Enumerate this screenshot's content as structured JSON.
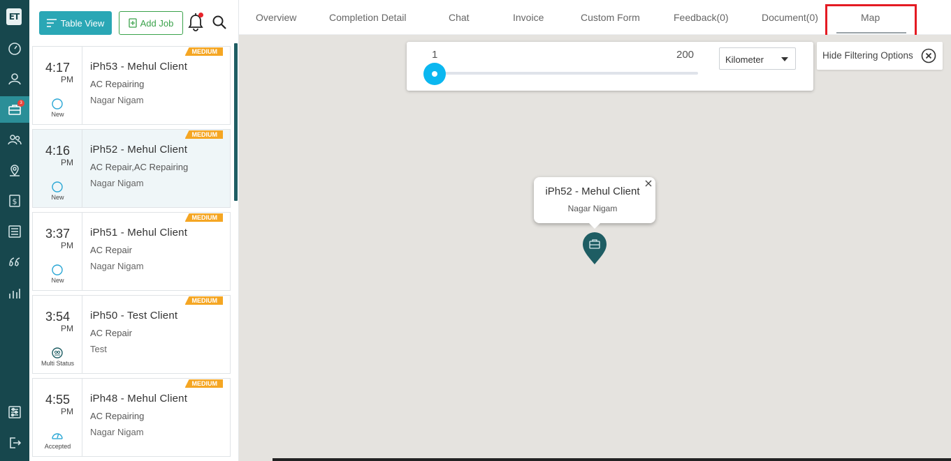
{
  "app": {
    "logo_text": "ET"
  },
  "rail": {
    "items": [
      {
        "icon": "dashboard-icon"
      },
      {
        "icon": "user-icon"
      },
      {
        "icon": "briefcase-icon",
        "badge": "3",
        "active": true
      },
      {
        "icon": "users-icon"
      },
      {
        "icon": "location-icon"
      },
      {
        "icon": "dollar-icon"
      },
      {
        "icon": "list-icon"
      },
      {
        "icon": "quote-icon"
      },
      {
        "icon": "reports-icon"
      },
      {
        "icon": "settings-sliders-icon"
      },
      {
        "icon": "logout-icon"
      }
    ]
  },
  "toolbar": {
    "table_view_label": "Table View",
    "add_job_label": "Add Job"
  },
  "jobs": [
    {
      "time": "4:17",
      "ampm": "PM",
      "title": "iPh53 - Mehul Client",
      "service": "AC Repairing",
      "location": "Nagar Nigam",
      "status": "New",
      "priority": "MEDIUM",
      "selected": false
    },
    {
      "time": "4:16",
      "ampm": "PM",
      "title": "iPh52 - Mehul Client",
      "service": "AC Repair,AC Repairing",
      "location": "Nagar Nigam",
      "status": "New",
      "priority": "MEDIUM",
      "selected": true
    },
    {
      "time": "3:37",
      "ampm": "PM",
      "title": "iPh51 - Mehul Client",
      "service": "AC Repair",
      "location": "Nagar Nigam",
      "status": "New",
      "priority": "MEDIUM",
      "selected": false
    },
    {
      "time": "3:54",
      "ampm": "PM",
      "title": "iPh50 - Test Client",
      "service": "AC Repair",
      "location": "Test",
      "status": "Multi Status",
      "priority": "MEDIUM",
      "selected": false
    },
    {
      "time": "4:55",
      "ampm": "PM",
      "title": "iPh48 - Mehul Client",
      "service": "AC Repairing",
      "location": "Nagar Nigam",
      "status": "Accepted",
      "priority": "MEDIUM",
      "selected": false
    }
  ],
  "tabs": [
    {
      "label": "Overview"
    },
    {
      "label": "Completion Detail"
    },
    {
      "label": "Chat"
    },
    {
      "label": "Invoice"
    },
    {
      "label": "Custom Form"
    },
    {
      "label": "Feedback(0)"
    },
    {
      "label": "Document(0)"
    },
    {
      "label": "Map",
      "active": true
    }
  ],
  "filter": {
    "range_min": "1",
    "range_max": "200",
    "slider_value": 1,
    "unit": "Kilometer",
    "hide_label": "Hide Filtering Options"
  },
  "popup": {
    "title": "iPh52 - Mehul Client",
    "subtitle": "Nagar Nigam"
  },
  "colors": {
    "rail_bg": "#17474d",
    "accent_teal": "#2aa7b5",
    "add_green": "#3aa24a",
    "priority_orange": "#f5a623",
    "slider_blue": "#0bb7f0",
    "highlight_red": "#e41b23",
    "map_bg": "#e5e3df"
  }
}
